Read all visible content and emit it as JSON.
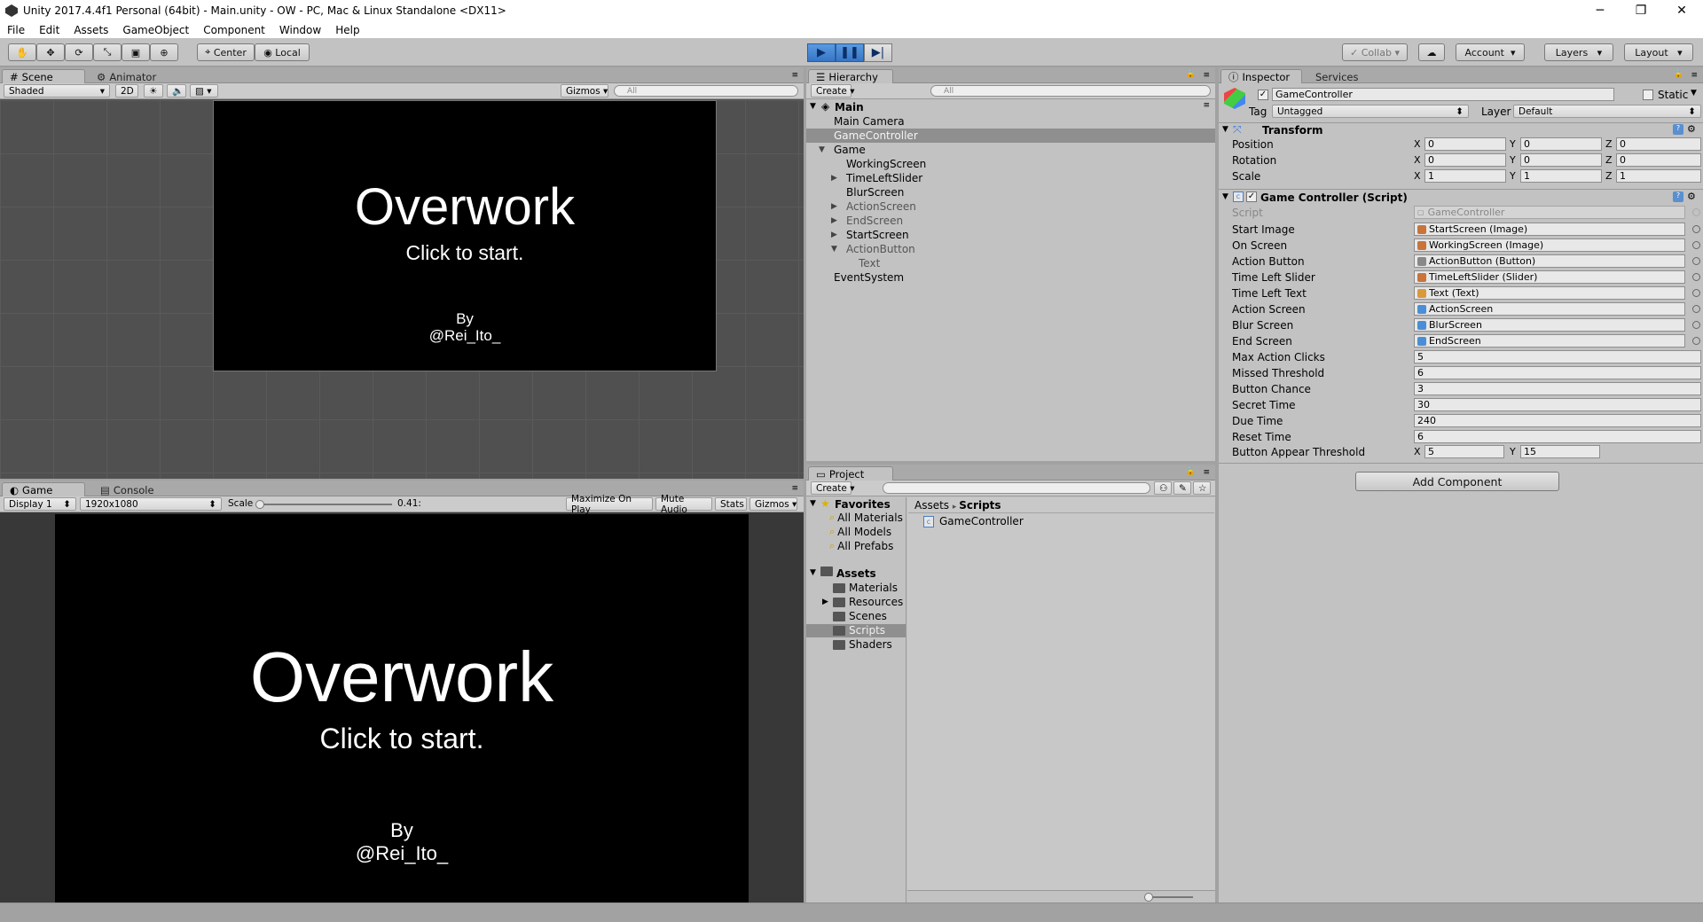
{
  "window": {
    "title": "Unity 2017.4.4f1 Personal (64bit) - Main.unity - OW - PC, Mac & Linux Standalone <DX11>",
    "minimize": "─",
    "maximize": "❐",
    "close": "✕"
  },
  "menu": [
    "File",
    "Edit",
    "Assets",
    "GameObject",
    "Component",
    "Window",
    "Help"
  ],
  "toolbar": {
    "center": "Center",
    "local": "Local",
    "collab": "Collab",
    "account": "Account",
    "layers": "Layers",
    "layout": "Layout"
  },
  "scene": {
    "tabs": [
      "Scene",
      "Animator"
    ],
    "shading": "Shaded",
    "mode2d": "2D",
    "gizmos": "Gizmos",
    "search_placeholder": "All",
    "title": "Overwork",
    "subtitle": "Click to start.",
    "by": "By",
    "author": "@Rei_Ito_"
  },
  "game": {
    "tabs": [
      "Game",
      "Console"
    ],
    "display": "Display 1",
    "resolution": "1920x1080",
    "scale_label": "Scale",
    "scale_value": "0.41:",
    "scale_fraction": 0.41,
    "buttons": [
      "Maximize On Play",
      "Mute Audio",
      "Stats",
      "Gizmos"
    ],
    "title": "Overwork",
    "subtitle": "Click to start.",
    "by": "By",
    "author": "@Rei_Ito_"
  },
  "hierarchy": {
    "tab": "Hierarchy",
    "create": "Create",
    "search_placeholder": "All",
    "scene": "Main",
    "items": [
      {
        "label": "Main Camera",
        "depth": 1,
        "arrow": "",
        "dim": false,
        "selected": false
      },
      {
        "label": "GameController",
        "depth": 1,
        "arrow": "",
        "dim": false,
        "selected": true
      },
      {
        "label": "Game",
        "depth": 1,
        "arrow": "▼",
        "dim": false,
        "selected": false
      },
      {
        "label": "WorkingScreen",
        "depth": 2,
        "arrow": "",
        "dim": false,
        "selected": false
      },
      {
        "label": "TimeLeftSlider",
        "depth": 2,
        "arrow": "▶",
        "dim": false,
        "selected": false
      },
      {
        "label": "BlurScreen",
        "depth": 2,
        "arrow": "",
        "dim": false,
        "selected": false
      },
      {
        "label": "ActionScreen",
        "depth": 2,
        "arrow": "▶",
        "dim": true,
        "selected": false
      },
      {
        "label": "EndScreen",
        "depth": 2,
        "arrow": "▶",
        "dim": true,
        "selected": false
      },
      {
        "label": "StartScreen",
        "depth": 2,
        "arrow": "▶",
        "dim": false,
        "selected": false
      },
      {
        "label": "ActionButton",
        "depth": 2,
        "arrow": "▼",
        "dim": true,
        "selected": false
      },
      {
        "label": "Text",
        "depth": 3,
        "arrow": "",
        "dim": true,
        "selected": false
      },
      {
        "label": "EventSystem",
        "depth": 1,
        "arrow": "",
        "dim": false,
        "selected": false
      }
    ]
  },
  "project": {
    "tab": "Project",
    "create": "Create",
    "favorites": "Favorites",
    "fav_items": [
      "All Materials",
      "All Models",
      "All Prefabs"
    ],
    "assets": "Assets",
    "folders": [
      "Materials",
      "Resources",
      "Scenes",
      "Scripts",
      "Shaders"
    ],
    "breadcrumb": [
      "Assets",
      "Scripts"
    ],
    "files": [
      "GameController"
    ]
  },
  "inspector": {
    "tabs": [
      "Inspector",
      "Services"
    ],
    "object_name": "GameController",
    "static": "Static",
    "tag_label": "Tag",
    "tag": "Untagged",
    "layer_label": "Layer",
    "layer": "Default",
    "transform": {
      "title": "Transform",
      "rows": [
        {
          "label": "Position",
          "x": "0",
          "y": "0",
          "z": "0"
        },
        {
          "label": "Rotation",
          "x": "0",
          "y": "0",
          "z": "0"
        },
        {
          "label": "Scale",
          "x": "1",
          "y": "1",
          "z": "1"
        }
      ]
    },
    "script": {
      "title": "Game Controller (Script)",
      "script_label": "Script",
      "script_value": "GameController",
      "refs": [
        {
          "label": "Start Image",
          "value": "StartScreen (Image)",
          "color": "#c8743a"
        },
        {
          "label": "On Screen",
          "value": "WorkingScreen (Image)",
          "color": "#c8743a"
        },
        {
          "label": "Action Button",
          "value": "ActionButton (Button)",
          "color": "#888888"
        },
        {
          "label": "Time Left Slider",
          "value": "TimeLeftSlider (Slider)",
          "color": "#c8743a"
        },
        {
          "label": "Time Left Text",
          "value": "Text (Text)",
          "color": "#d99a3b"
        },
        {
          "label": "Action Screen",
          "value": "ActionScreen",
          "color": "#4a8fd6"
        },
        {
          "label": "Blur Screen",
          "value": "BlurScreen",
          "color": "#4a8fd6"
        },
        {
          "label": "End Screen",
          "value": "EndScreen",
          "color": "#4a8fd6"
        }
      ],
      "values": [
        {
          "label": "Max Action Clicks",
          "value": "5"
        },
        {
          "label": "Missed Threshold",
          "value": "6"
        },
        {
          "label": "Button Chance",
          "value": "3"
        },
        {
          "label": "Secret Time",
          "value": "30"
        },
        {
          "label": "Due Time",
          "value": "240"
        },
        {
          "label": "Reset Time",
          "value": "6"
        }
      ],
      "threshold": {
        "label": "Button Appear Threshold",
        "x": "5",
        "y": "15"
      }
    },
    "add_component": "Add Component"
  }
}
